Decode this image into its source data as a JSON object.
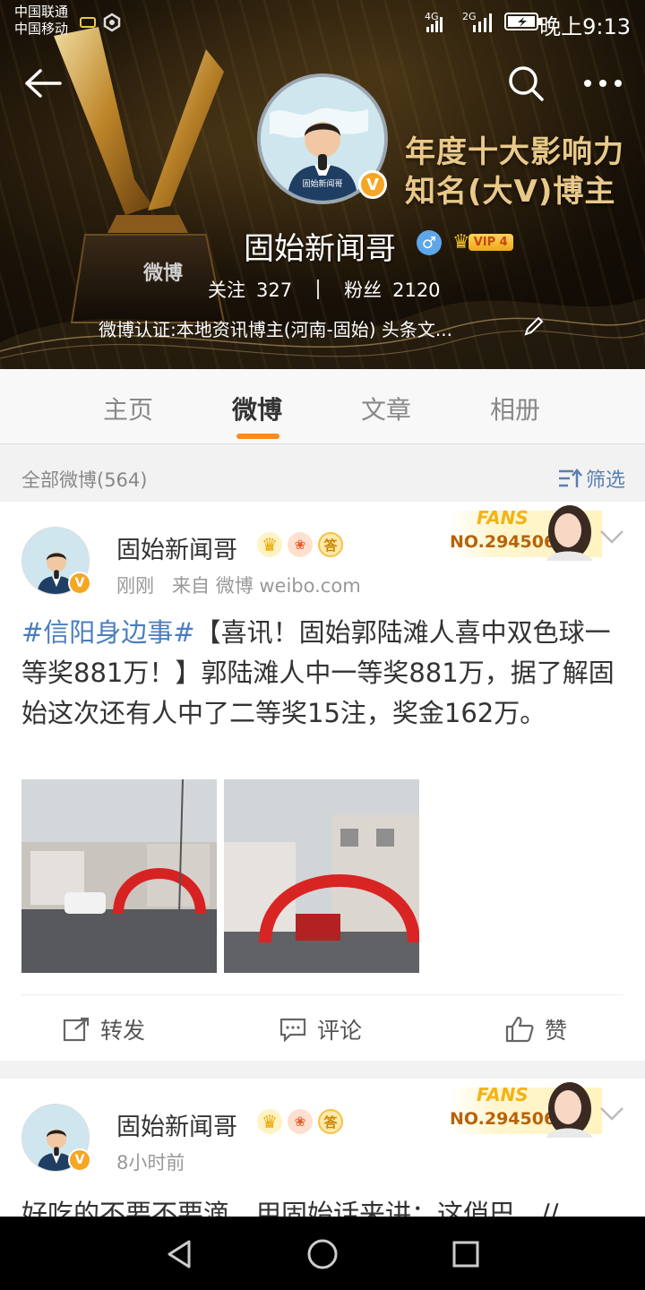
{
  "status_bar": {
    "carrier1": "中国联通",
    "carrier2": "中国移动",
    "network1": "4G",
    "network2": "2G",
    "time": "晚上9:13"
  },
  "banner": {
    "line1": "年度十大影响力",
    "line2": "知名(大V)博主",
    "trophy_logo": "微博"
  },
  "profile": {
    "name": "固始新闻哥",
    "vip_label": "VIP 4",
    "following_label": "关注",
    "following_count": "327",
    "fans_label": "粉丝",
    "fans_count": "2120",
    "verification": "微博认证:本地资讯博主(河南-固始) 头条文..."
  },
  "tabs": [
    {
      "label": "主页",
      "active": false
    },
    {
      "label": "微博",
      "active": true
    },
    {
      "label": "文章",
      "active": false
    },
    {
      "label": "相册",
      "active": false
    }
  ],
  "filter": {
    "count_label": "全部微博(564)",
    "button_label": "筛选"
  },
  "posts": [
    {
      "author": "固始新闻哥",
      "time": "刚刚",
      "source": "来自 微博 weibo.com",
      "hashtag": "#信阳身边事#",
      "text": "【喜讯！固始郭陆滩人喜中双色球一等奖881万！】郭陆滩人中一等奖881万，据了解固始这次还有人中了二等奖15注，奖金162万。",
      "fans_label": "FANS",
      "fans_no": "NO.294506",
      "actions": {
        "repost": "转发",
        "comment": "评论",
        "like": "赞"
      }
    },
    {
      "author": "固始新闻哥",
      "time": "8小时前",
      "text": "好吃的不要不要滴，用固始话来讲：这俏巴。//",
      "fans_label": "FANS",
      "fans_no": "NO.294506"
    }
  ],
  "colors": {
    "accent": "#f88b1f",
    "link": "#4a7dbd",
    "vip_gold": "#f0a917"
  }
}
